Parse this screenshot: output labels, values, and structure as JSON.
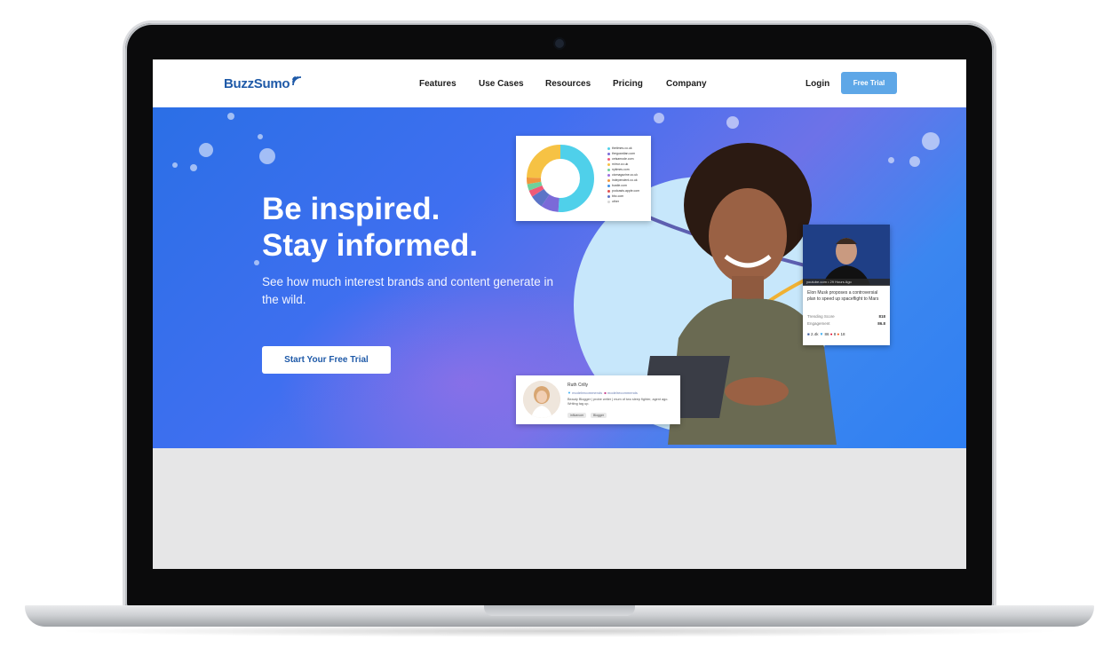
{
  "nav": {
    "logo": "BuzzSumo",
    "items": [
      "Features",
      "Use Cases",
      "Resources",
      "Pricing",
      "Company"
    ],
    "login": "Login",
    "trial_button": "Free Trial"
  },
  "hero": {
    "headline_line1": "Be inspired.",
    "headline_line2": "Stay informed.",
    "subheadline": "See how much interest brands and content generate in the wild.",
    "cta": "Start Your Free Trial"
  },
  "donut_card": {
    "legend": [
      "thetimes.co.uk",
      "theguardian.com",
      "ceisamode.com",
      "mirror.co.uk",
      "nytimes.com",
      "ciomagazine.co.uk",
      "independent.co.uk",
      "bustle.com",
      "podcasts.apple.com",
      "bbc.com",
      "other"
    ],
    "colors": [
      "#4fd0ea",
      "#7b6ad8",
      "#f05a78",
      "#f6c244",
      "#6fd19b",
      "#a070e0",
      "#f0963d",
      "#3f8fe6",
      "#e05050",
      "#5c74c7",
      "#d6d6d6"
    ]
  },
  "news_card": {
    "meta": "youtube.com • 29 Hours Ago",
    "title": "Elon Musk proposes a controversial plan to speed up spaceflight to Mars",
    "trending_label": "Trending Score",
    "trending_value": "818",
    "engagement_label": "Engagement",
    "engagement_value": "86.8",
    "social": [
      "2.4k",
      "86",
      "8",
      "18"
    ]
  },
  "profile_card": {
    "name": "Ruth Crilly",
    "twitter": "modelrecommends",
    "instagram": "modelrecommends",
    "bio": "Beauty Blogger | probe writer | mum of two sleep fighter, agent ago. Writing tag up.",
    "tags": [
      "influencer",
      "Blogger"
    ]
  },
  "colors": {
    "brand": "#1f5aa8",
    "cta_blue": "#5ea7e7",
    "hero_start": "#2b6fe6",
    "hero_end": "#2f7ff2"
  }
}
